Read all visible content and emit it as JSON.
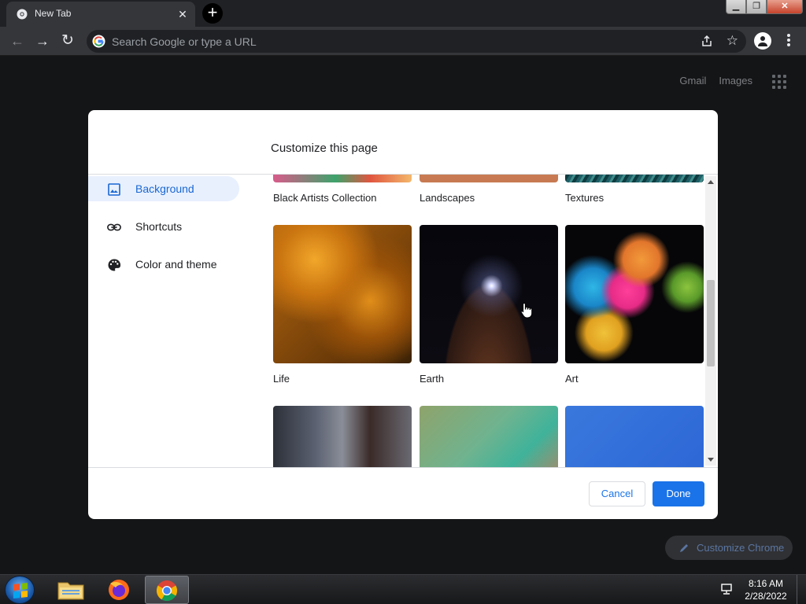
{
  "browser": {
    "tab_title": "New Tab",
    "omnibox_placeholder": "Search Google or type a URL"
  },
  "ntp": {
    "links": [
      "Gmail",
      "Images"
    ],
    "customize_chrome_label": "Customize Chrome"
  },
  "dialog": {
    "title": "Customize this page",
    "sidebar": [
      {
        "label": "Background",
        "icon": "image-icon",
        "active": true
      },
      {
        "label": "Shortcuts",
        "icon": "link-icon",
        "active": false
      },
      {
        "label": "Color and theme",
        "icon": "palette-icon",
        "active": false
      }
    ],
    "collections_row1": [
      "Black Artists Collection",
      "Landscapes",
      "Textures"
    ],
    "collections_row2": [
      "Life",
      "Earth",
      "Art"
    ],
    "cancel_label": "Cancel",
    "done_label": "Done"
  },
  "taskbar": {
    "pinned": [
      "windows-explorer",
      "firefox",
      "chrome"
    ],
    "active_app": "chrome",
    "time": "8:16 AM",
    "date": "2/28/2022"
  },
  "colors": {
    "accent": "#1a73e8",
    "selected_bg": "#e8f0fe",
    "page_bg": "#202124"
  }
}
